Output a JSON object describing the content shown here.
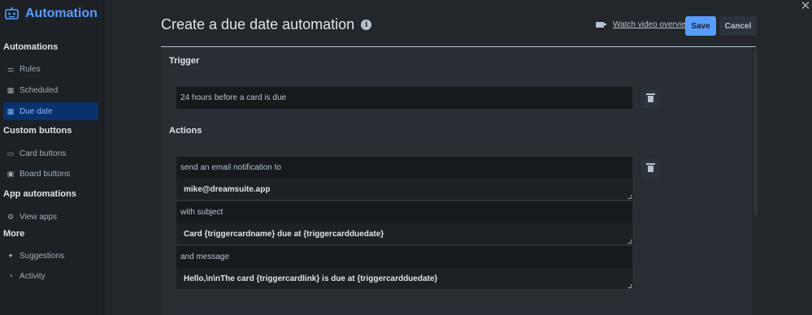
{
  "app": {
    "title": "Automation"
  },
  "sidebar": {
    "sections": [
      {
        "heading": "Automations"
      },
      {
        "heading": "Custom buttons"
      },
      {
        "heading": "App automations"
      },
      {
        "heading": "More"
      }
    ],
    "items": [
      {
        "label": "Rules",
        "icon": "sliders-icon"
      },
      {
        "label": "Scheduled",
        "icon": "calendar-icon"
      },
      {
        "label": "Due date",
        "icon": "calendar-clock-icon",
        "active": true
      },
      {
        "label": "Card buttons",
        "icon": "card-icon"
      },
      {
        "label": "Board buttons",
        "icon": "board-icon"
      },
      {
        "label": "View apps",
        "icon": "gear-icon"
      },
      {
        "label": "Suggestions",
        "icon": "sparkle-icon"
      },
      {
        "label": "Activity",
        "icon": "activity-icon"
      }
    ]
  },
  "header": {
    "title": "Create a due date automation",
    "info_glyph": "i",
    "video_link": "Watch video overview",
    "save_label": "Save",
    "cancel_label": "Cancel",
    "close_glyph": "✕"
  },
  "trigger": {
    "heading": "Trigger",
    "value": "24 hours before a card is due"
  },
  "actions": {
    "heading": "Actions",
    "lines": [
      "send an email notification to",
      "mike@dreamsuite.app",
      "with subject",
      "Card {triggercardname} due at {triggercardduedate}",
      "and message",
      "Hello,\\n\\nThe card {triggercardlink} is due at {triggercardduedate}"
    ]
  },
  "colors": {
    "accent": "#579dff",
    "sidebar_active_bg": "#09326c",
    "background": "#22272b"
  }
}
